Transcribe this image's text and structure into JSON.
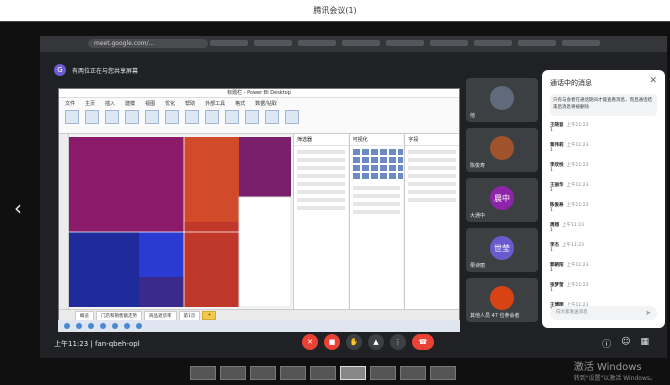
{
  "window": {
    "title": "腾讯会议(1)"
  },
  "browser": {
    "url": "meet.google.com/..."
  },
  "banner": {
    "avatar_letter": "G",
    "text": "有两位正在与您共享屏幕"
  },
  "powerbi": {
    "title": "标题栏 - Power BI Desktop",
    "ribbon_tabs": [
      "文件",
      "主页",
      "插入",
      "建模",
      "视图",
      "优化",
      "帮助",
      "外部工具",
      "格式",
      "数据/钻取"
    ],
    "pane_filter": "筛选器",
    "pane_viz": "可视化",
    "pane_fields": "字段",
    "page_tabs": [
      "概览",
      "门店和销售额走势",
      "商品退货率",
      "第1页"
    ],
    "add_tab": "+"
  },
  "tiles": [
    {
      "name": "他",
      "letter": "",
      "color": "#5f6b7a"
    },
    {
      "name": "陈俊寿",
      "letter": "",
      "color": "#a0522d"
    },
    {
      "name": "大通中",
      "letter": "晨中",
      "color": "#8e24aa"
    },
    {
      "name": "栗诗丽",
      "letter": "世莹",
      "color": "#6a5acd"
    },
    {
      "name": "其他人员 47 位参会者",
      "letter": "",
      "color": "#d84315"
    }
  ],
  "chat": {
    "title": "通话中的消息",
    "note": "只有与会者在通话期间才能查看消息，而且通话结束后消息将被删除",
    "messages": [
      {
        "sender": "王晓音",
        "time": "上午11:23",
        "text": "1"
      },
      {
        "sender": "蒋伟莉",
        "time": "上午11:23",
        "text": "1"
      },
      {
        "sender": "李欣悦",
        "time": "上午11:23",
        "text": "1"
      },
      {
        "sender": "王丽华",
        "time": "上午11:23",
        "text": "1"
      },
      {
        "sender": "陈俊寿",
        "time": "上午11:23",
        "text": "1"
      },
      {
        "sender": "周翔",
        "time": "上午11:23",
        "text": "1"
      },
      {
        "sender": "李杰",
        "time": "上午11:23",
        "text": "1"
      },
      {
        "sender": "郭朝阳",
        "time": "上午11:23",
        "text": "1"
      },
      {
        "sender": "张梦莹",
        "time": "上午11:23",
        "text": "1"
      },
      {
        "sender": "王博翔",
        "time": "上午11:23",
        "text": "1"
      }
    ],
    "input_placeholder": "向大家发送消息",
    "send_icon": "send-icon"
  },
  "controls": {
    "clock": "上午11:23 | fan-qbeh-opl"
  },
  "watermark": {
    "line1": "激活 Windows",
    "line2": "转到\"设置\"以激活 Windows。"
  }
}
